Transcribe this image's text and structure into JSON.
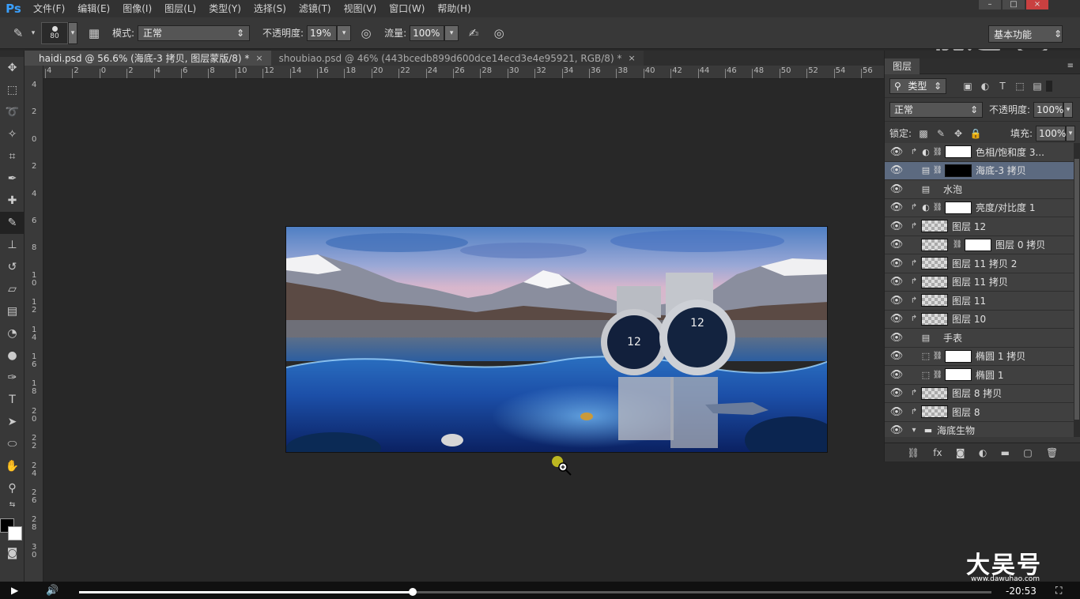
{
  "menubar": {
    "logo": "Ps",
    "items": [
      "文件(F)",
      "编辑(E)",
      "图像(I)",
      "图层(L)",
      "类型(Y)",
      "选择(S)",
      "滤镜(T)",
      "视图(V)",
      "窗口(W)",
      "帮助(H)"
    ]
  },
  "watermark": {
    "top": "视达",
    "bottom": "大吴号",
    "url": "www.dawuhao.com"
  },
  "options": {
    "brush_size": "80",
    "mode_label": "模式:",
    "mode_value": "正常",
    "opacity_label": "不透明度:",
    "opacity_value": "19%",
    "flow_label": "流量:",
    "flow_value": "100%",
    "workspace": "基本功能"
  },
  "tabs": [
    {
      "label": "haidi.psd @ 56.6% (海底-3 拷贝, 图层蒙版/8) *"
    },
    {
      "label": "shoubiao.psd @ 46% (443bcedb899d600dce14ecd3e4e95921, RGB/8) *"
    }
  ],
  "ruler_h": [
    "4",
    "2",
    "0",
    "2",
    "4",
    "6",
    "8",
    "10",
    "12",
    "14",
    "16",
    "18",
    "20",
    "22",
    "24",
    "26",
    "28",
    "30",
    "32",
    "34",
    "36",
    "38",
    "40",
    "42",
    "44",
    "46",
    "48",
    "50",
    "52",
    "54",
    "56"
  ],
  "ruler_v": [
    "4",
    "2",
    "0",
    "2",
    "4",
    "6",
    "8",
    "1 0",
    "1 2",
    "1 4",
    "1 6",
    "1 8",
    "2 0",
    "2 2",
    "2 4",
    "2 6",
    "2 8",
    "3 0"
  ],
  "layers_panel": {
    "tab": "图层",
    "filter_label": "类型",
    "blend_mode": "正常",
    "opacity_label": "不透明度:",
    "opacity_value": "100%",
    "lock_label": "锁定:",
    "fill_label": "填充:",
    "fill_value": "100%",
    "layers": [
      {
        "name": "色相/饱和度 3...",
        "clip": true,
        "type": "adjust",
        "link": true,
        "thumb": "white",
        "mask": false,
        "selected": false
      },
      {
        "name": "海底-3 拷贝",
        "clip": false,
        "type": "smart",
        "link": true,
        "thumb": "black",
        "mask": false,
        "selected": true
      },
      {
        "name": "水泡",
        "clip": false,
        "type": "smart",
        "link": false,
        "thumb": "none",
        "mask": false,
        "selected": false
      },
      {
        "name": "亮度/对比度 1",
        "clip": true,
        "type": "adjust",
        "link": true,
        "thumb": "white",
        "mask": false,
        "selected": false
      },
      {
        "name": "图层 12",
        "clip": true,
        "type": "pixel",
        "link": false,
        "thumb": "checker",
        "mask": false,
        "selected": false
      },
      {
        "name": "图层 0 拷贝",
        "clip": false,
        "type": "pixel",
        "link": true,
        "thumb": "checker",
        "mask": true,
        "selected": false
      },
      {
        "name": "图层 11 拷贝 2",
        "clip": true,
        "type": "pixel",
        "link": false,
        "thumb": "checker",
        "mask": false,
        "selected": false
      },
      {
        "name": "图层 11 拷贝",
        "clip": true,
        "type": "pixel",
        "link": false,
        "thumb": "checker",
        "mask": false,
        "selected": false
      },
      {
        "name": "图层 11",
        "clip": true,
        "type": "pixel",
        "link": false,
        "thumb": "checker",
        "mask": false,
        "selected": false
      },
      {
        "name": "图层 10",
        "clip": true,
        "type": "pixel",
        "link": false,
        "thumb": "checker",
        "mask": false,
        "selected": false
      },
      {
        "name": "手表",
        "clip": false,
        "type": "smart",
        "link": false,
        "thumb": "none",
        "mask": false,
        "selected": false
      },
      {
        "name": "椭圆 1 拷贝",
        "clip": false,
        "type": "shape",
        "link": true,
        "thumb": "white",
        "mask": false,
        "selected": false
      },
      {
        "name": "椭圆 1",
        "clip": false,
        "type": "shape",
        "link": true,
        "thumb": "white",
        "mask": false,
        "selected": false
      },
      {
        "name": "图层 8 拷贝",
        "clip": true,
        "type": "pixel",
        "link": false,
        "thumb": "checker",
        "mask": false,
        "selected": false
      },
      {
        "name": "图层 8",
        "clip": true,
        "type": "pixel",
        "link": false,
        "thumb": "checker",
        "mask": false,
        "selected": false
      },
      {
        "name": "海底生物",
        "clip": false,
        "type": "group",
        "link": false,
        "thumb": "none",
        "mask": false,
        "selected": false
      }
    ]
  },
  "video": {
    "time": "-20:53",
    "progress": 0.366
  }
}
